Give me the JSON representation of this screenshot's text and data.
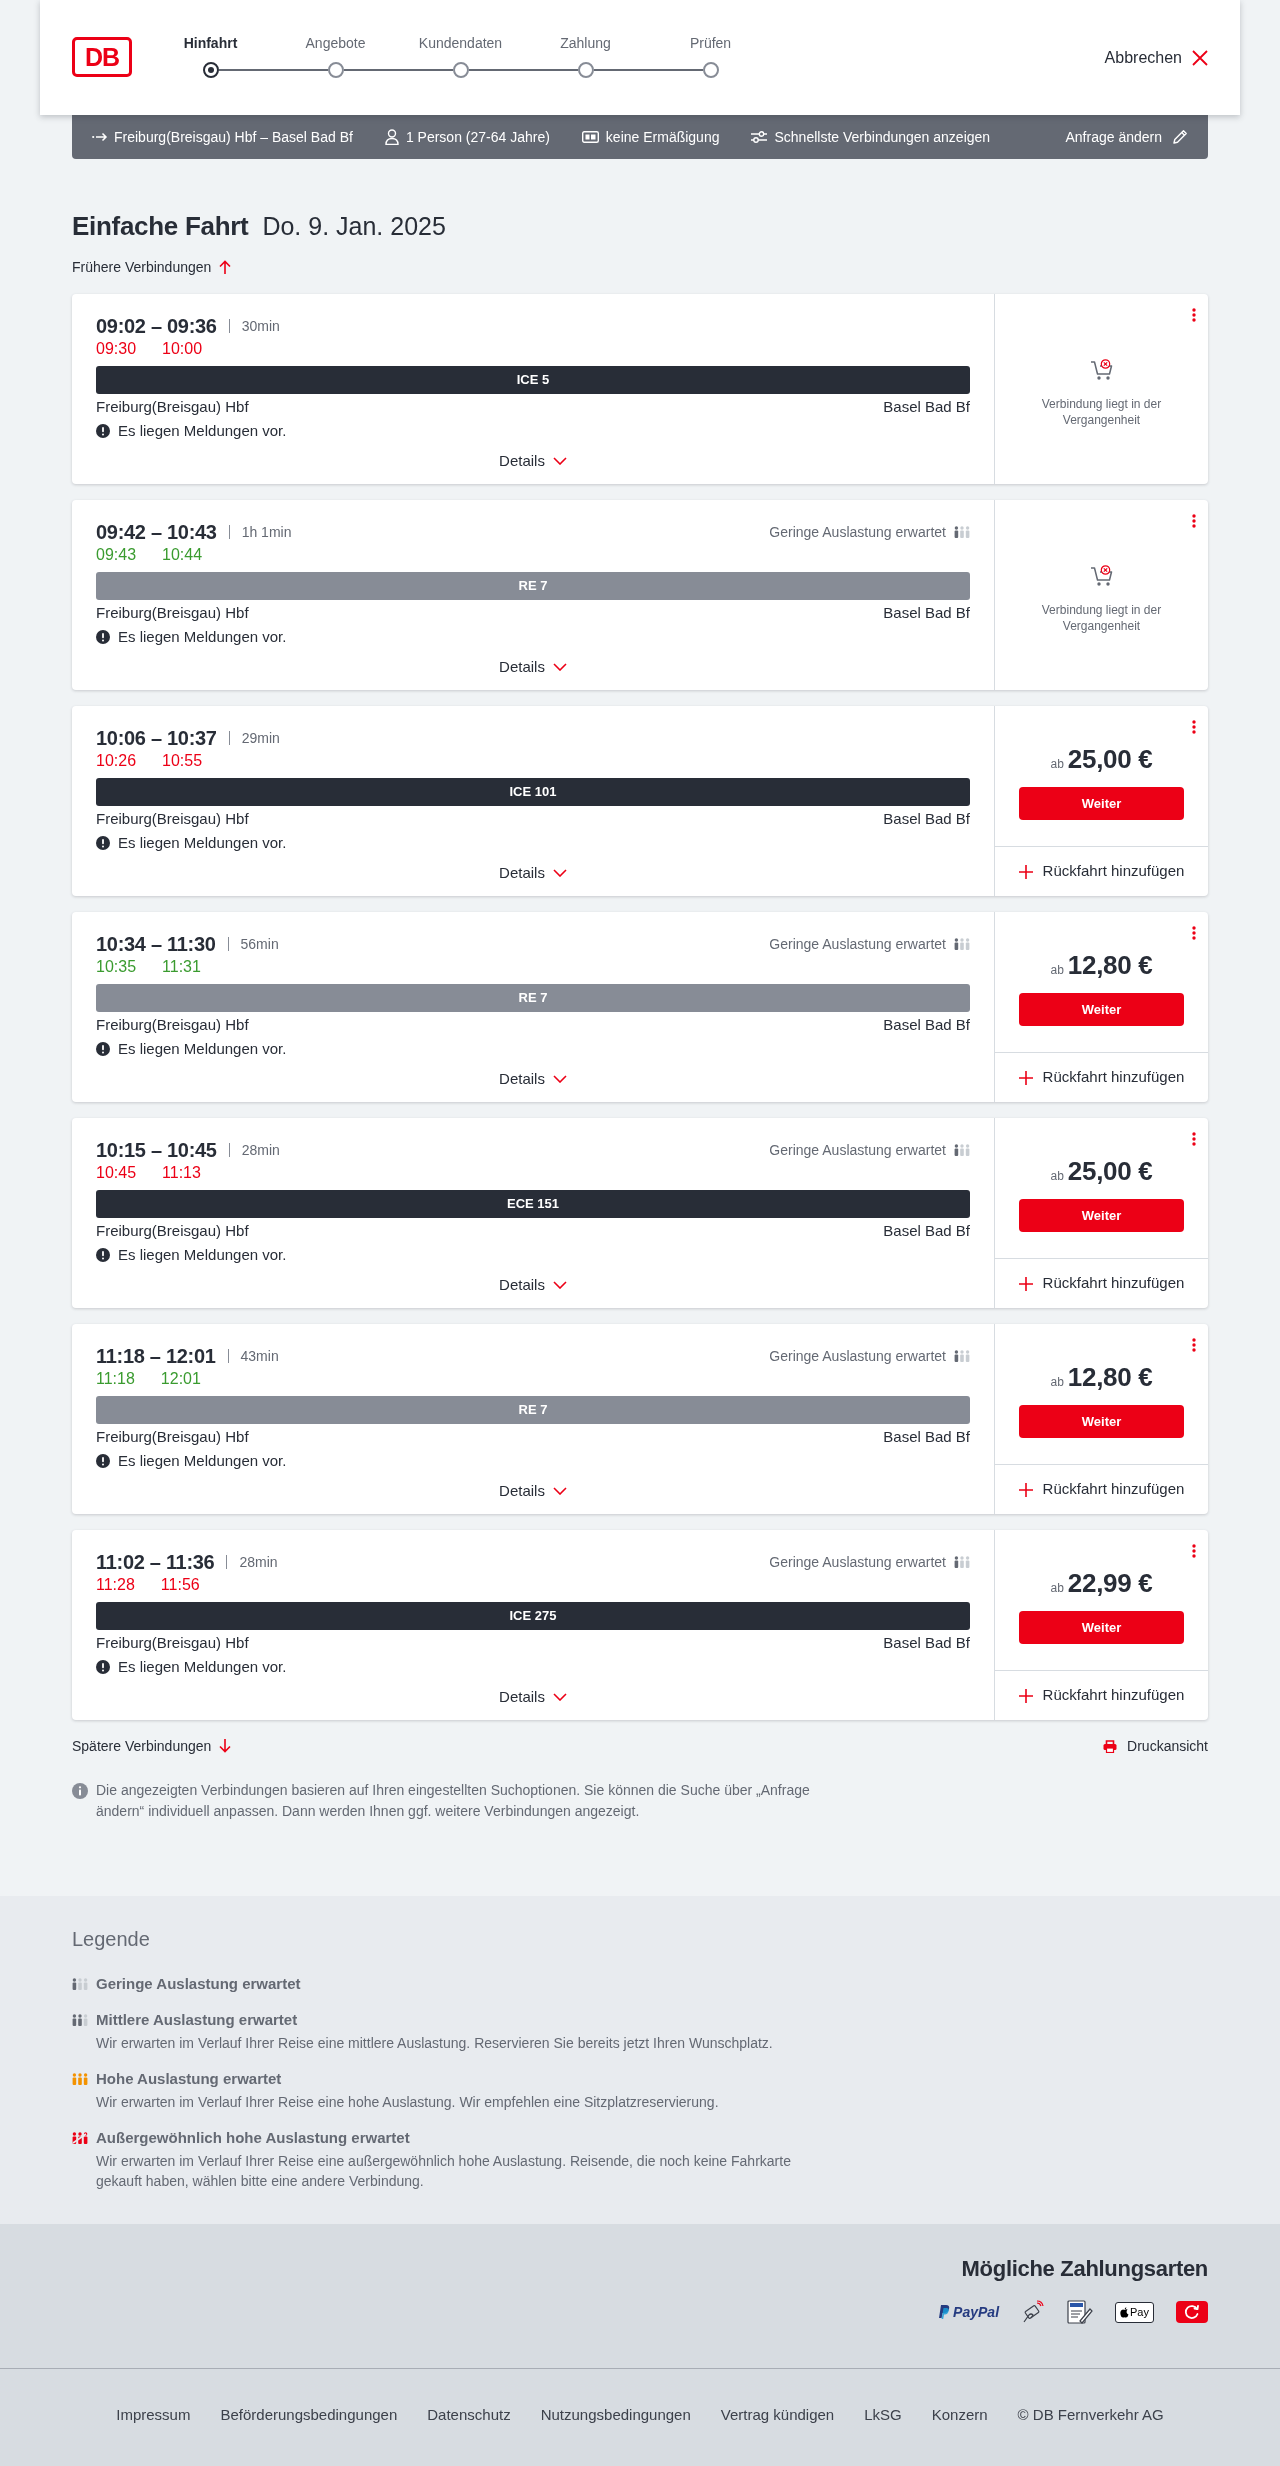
{
  "header": {
    "logo": "DB",
    "steps": [
      {
        "label": "Hinfahrt",
        "selected": true
      },
      {
        "label": "Angebote",
        "selected": false
      },
      {
        "label": "Kundendaten",
        "selected": false
      },
      {
        "label": "Zahlung",
        "selected": false
      },
      {
        "label": "Prüfen",
        "selected": false
      }
    ],
    "cancel": "Abbrechen"
  },
  "search_summary": {
    "route": "Freiburg(Breisgau) Hbf – Basel Bad Bf",
    "travellers": "1 Person (27-64 Jahre)",
    "discount": "keine Ermäßigung",
    "option": "Schnellste Verbindungen anzeigen",
    "edit": "Anfrage ändern"
  },
  "heading": {
    "title": "Einfache Fahrt",
    "date": "Do. 9. Jan. 2025"
  },
  "earlier": "Frühere Verbindungen",
  "connections": [
    {
      "time": "09:02 – 09:36",
      "duration": "30min",
      "realtime_departure": "09:30",
      "realtime_arrival": "10:00",
      "delayed": true,
      "train": {
        "kind": "ice",
        "name": "ICE 5"
      },
      "from": "Freiburg(Breisgau) Hbf",
      "to": "Basel Bad Bf",
      "message": "Es liegen Meldungen vor.",
      "details": "Details",
      "offer": {
        "kind": "past",
        "text": "Verbindung liegt in der Vergangenheit"
      }
    },
    {
      "time": "09:42 – 10:43",
      "duration": "1h 1min",
      "realtime_departure": "09:43",
      "realtime_arrival": "10:44",
      "delayed": false,
      "occupancy": {
        "kind": "low",
        "label": "Geringe Auslastung erwartet"
      },
      "train": {
        "kind": "re",
        "name": "RE 7"
      },
      "from": "Freiburg(Breisgau) Hbf",
      "to": "Basel Bad Bf",
      "message": "Es liegen Meldungen vor.",
      "details": "Details",
      "offer": {
        "kind": "past",
        "text": "Verbindung liegt in der Vergangenheit"
      }
    },
    {
      "time": "10:06 – 10:37",
      "duration": "29min",
      "realtime_departure": "10:26",
      "realtime_arrival": "10:55",
      "delayed": true,
      "train": {
        "kind": "ice",
        "name": "ICE 101"
      },
      "from": "Freiburg(Breisgau) Hbf",
      "to": "Basel Bad Bf",
      "message": "Es liegen Meldungen vor.",
      "details": "Details",
      "offer": {
        "kind": "price",
        "prefix": "ab",
        "price": "25,00 €",
        "button": "Weiter",
        "return": "Rückfahrt hinzufügen"
      }
    },
    {
      "time": "10:34 – 11:30",
      "duration": "56min",
      "realtime_departure": "10:35",
      "realtime_arrival": "11:31",
      "delayed": false,
      "occupancy": {
        "kind": "low",
        "label": "Geringe Auslastung erwartet"
      },
      "train": {
        "kind": "re",
        "name": "RE 7"
      },
      "from": "Freiburg(Breisgau) Hbf",
      "to": "Basel Bad Bf",
      "message": "Es liegen Meldungen vor.",
      "details": "Details",
      "offer": {
        "kind": "price",
        "prefix": "ab",
        "price": "12,80 €",
        "button": "Weiter",
        "return": "Rückfahrt hinzufügen"
      }
    },
    {
      "time": "10:15 – 10:45",
      "duration": "28min",
      "realtime_departure": "10:45",
      "realtime_arrival": "11:13",
      "delayed": true,
      "occupancy": {
        "kind": "low",
        "label": "Geringe Auslastung erwartet"
      },
      "train": {
        "kind": "ice",
        "name": "ECE 151"
      },
      "from": "Freiburg(Breisgau) Hbf",
      "to": "Basel Bad Bf",
      "message": "Es liegen Meldungen vor.",
      "details": "Details",
      "offer": {
        "kind": "price",
        "prefix": "ab",
        "price": "25,00 €",
        "button": "Weiter",
        "return": "Rückfahrt hinzufügen"
      }
    },
    {
      "time": "11:18 – 12:01",
      "duration": "43min",
      "realtime_departure": "11:18",
      "realtime_arrival": "12:01",
      "delayed": false,
      "occupancy": {
        "kind": "low",
        "label": "Geringe Auslastung erwartet"
      },
      "train": {
        "kind": "re",
        "name": "RE 7"
      },
      "from": "Freiburg(Breisgau) Hbf",
      "to": "Basel Bad Bf",
      "message": "Es liegen Meldungen vor.",
      "details": "Details",
      "offer": {
        "kind": "price",
        "prefix": "ab",
        "price": "12,80 €",
        "button": "Weiter",
        "return": "Rückfahrt hinzufügen"
      }
    },
    {
      "time": "11:02 – 11:36",
      "duration": "28min",
      "realtime_departure": "11:28",
      "realtime_arrival": "11:56",
      "delayed": true,
      "occupancy": {
        "kind": "low",
        "label": "Geringe Auslastung erwartet"
      },
      "train": {
        "kind": "ice",
        "name": "ICE 275"
      },
      "from": "Freiburg(Breisgau) Hbf",
      "to": "Basel Bad Bf",
      "message": "Es liegen Meldungen vor.",
      "details": "Details",
      "offer": {
        "kind": "price",
        "prefix": "ab",
        "price": "22,99 €",
        "button": "Weiter",
        "return": "Rückfahrt hinzufügen"
      }
    }
  ],
  "later": "Spätere Verbindungen",
  "print": "Druckansicht",
  "info": "Die angezeigten Verbindungen basieren auf Ihren eingestellten Suchoptionen. Sie können die Suche über „Anfrage ändern“ individuell anpassen. Dann werden Ihnen ggf. weitere Verbindungen angezeigt.",
  "legend": {
    "title": "Legende",
    "items": [
      {
        "kind": "low",
        "title": "Geringe Auslastung erwartet"
      },
      {
        "kind": "medium",
        "title": "Mittlere Auslastung erwartet",
        "text": "Wir erwarten im Verlauf Ihrer Reise eine mittlere Auslastung. Reservieren Sie bereits jetzt Ihren Wunschplatz."
      },
      {
        "kind": "high",
        "title": "Hohe Auslastung erwartet",
        "text": "Wir erwarten im Verlauf Ihrer Reise eine hohe Auslastung. Wir empfehlen eine Sitzplatzreservierung."
      },
      {
        "kind": "extreme",
        "title": "Außergewöhnlich hohe Auslastung erwartet",
        "text": "Wir erwarten im Verlauf Ihrer Reise eine außergewöhnlich hohe Auslastung. Reisende, die noch keine Fahrkarte gekauft haben, wählen bitte eine andere Verbindung."
      }
    ]
  },
  "payment": {
    "title": "Mögliche Zahlungsarten",
    "methods": [
      {
        "kind": "paypal",
        "label": "PayPal"
      },
      {
        "kind": "card"
      },
      {
        "kind": "sepa"
      },
      {
        "kind": "applepay",
        "label": "Pay"
      },
      {
        "kind": "tile"
      }
    ]
  },
  "footer": {
    "links": [
      "Impressum",
      "Beförderungsbedingungen",
      "Datenschutz",
      "Nutzungsbedingungen",
      "Vertrag kündigen",
      "LkSG",
      "Konzern"
    ],
    "copyright": "© DB Fernverkehr AG"
  }
}
